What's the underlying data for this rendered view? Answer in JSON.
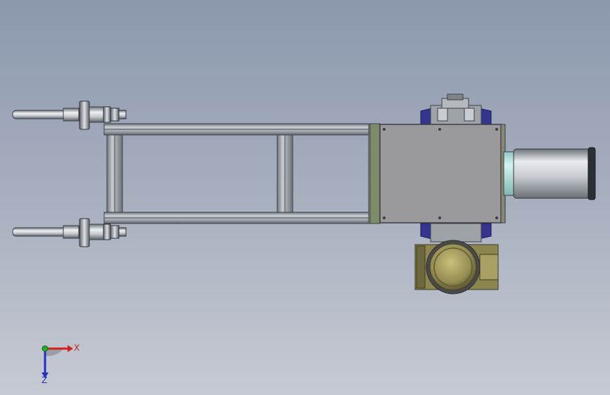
{
  "viewport": {
    "background_top": "#8b98ad",
    "background_bottom": "#c6cad3"
  },
  "model": {
    "frame_color": "#9aa1a8",
    "housing_color": "#9a9a9c",
    "flange_color": "#7f8c6a",
    "bracket_color": "#35358f",
    "motor_color": "#8c8550",
    "cylinder_color": "#d8dbe0",
    "cylinder_cap_color": "#a8e2dc"
  },
  "triad": {
    "x_label": "X",
    "z_label": "Z",
    "x_color": "#d02020",
    "y_color": "#20b030",
    "z_color": "#2030c0",
    "icon": "coordinate-triad-icon"
  }
}
